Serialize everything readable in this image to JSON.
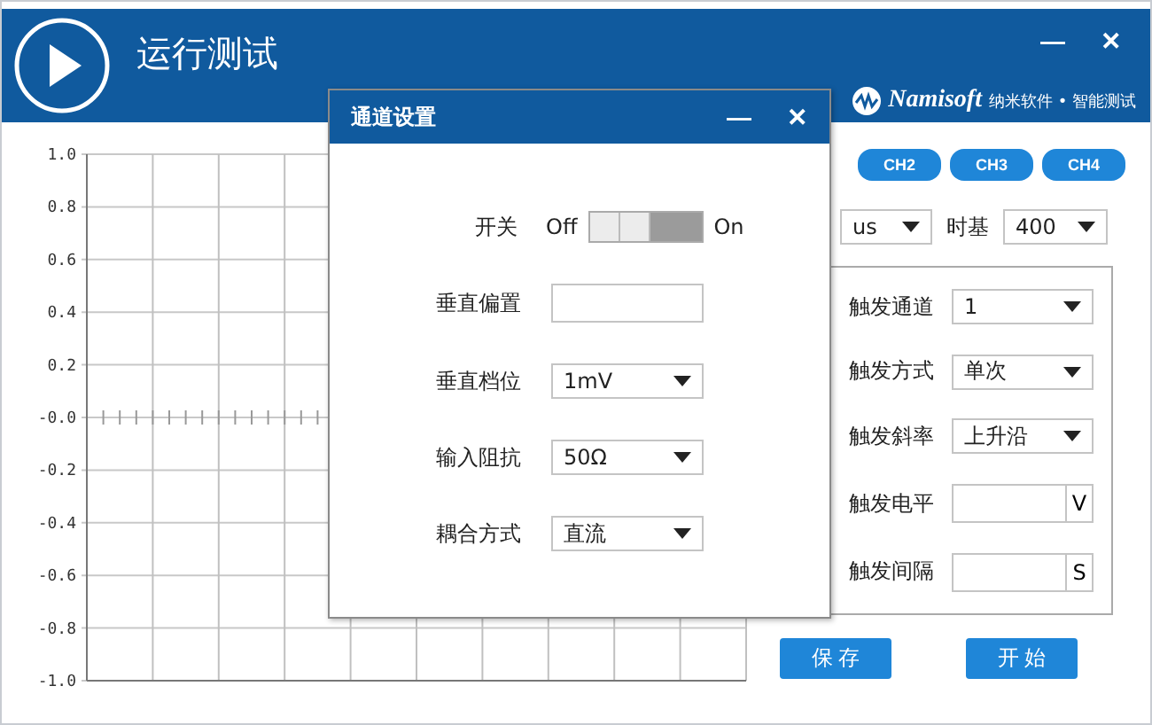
{
  "window": {
    "title": "运行测试",
    "minimize": "—",
    "close": "✕"
  },
  "brand": {
    "name": "Namisoft",
    "tagline": "纳米软件 • 智能测试"
  },
  "plot": {
    "y_axis_labels": [
      "1.0",
      "0.8",
      "0.6",
      "0.4",
      "0.2",
      "-0.0",
      "-0.2",
      "-0.4",
      "-0.6",
      "-0.8",
      "-1.0"
    ]
  },
  "channels": [
    {
      "label": "CH2",
      "selected": false
    },
    {
      "label": "CH3",
      "selected": false
    },
    {
      "label": "CH4",
      "selected": false
    }
  ],
  "timebase": {
    "unit": "us",
    "label": "时基",
    "value": "400"
  },
  "trigger": [
    {
      "kind": "select",
      "label": "触发通道",
      "value": "1"
    },
    {
      "kind": "select",
      "label": "触发方式",
      "value": "单次"
    },
    {
      "kind": "select",
      "label": "触发斜率",
      "value": "上升沿"
    },
    {
      "kind": "input",
      "label": "触发电平",
      "unit": "V"
    },
    {
      "kind": "input",
      "label": "触发间隔",
      "unit": "S"
    }
  ],
  "buttons": [
    "保 存",
    "开 始"
  ],
  "dialog": {
    "title": "通道设置",
    "minimize": "—",
    "close": "✕",
    "switch": {
      "label": "开关",
      "off": "Off",
      "on_label": "On",
      "on": true
    },
    "fields": [
      {
        "kind": "input",
        "label": "垂直偏置"
      },
      {
        "kind": "select",
        "label": "垂直档位",
        "value": "1mV"
      },
      {
        "kind": "select",
        "label": "输入阻抗",
        "value": "50Ω"
      },
      {
        "kind": "select",
        "label": "耦合方式",
        "value": "直流"
      }
    ]
  }
}
